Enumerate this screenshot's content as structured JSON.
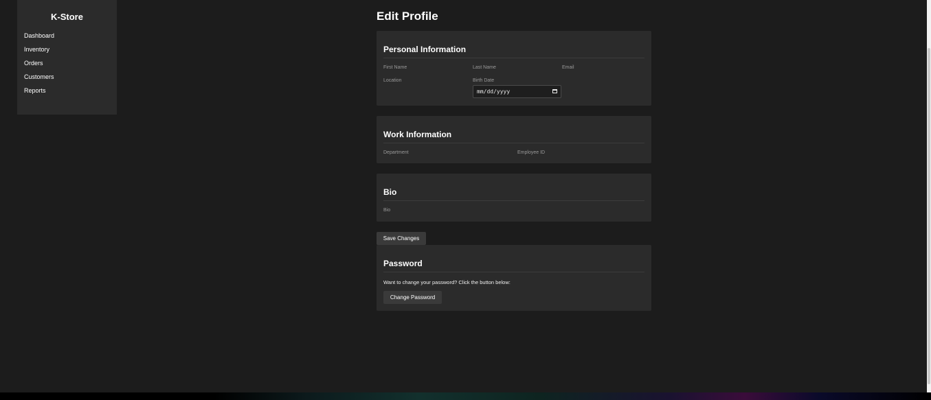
{
  "sidebar": {
    "brand": "K-Store",
    "items": [
      {
        "label": "Dashboard"
      },
      {
        "label": "Inventory"
      },
      {
        "label": "Orders"
      },
      {
        "label": "Customers"
      },
      {
        "label": "Reports"
      }
    ]
  },
  "page": {
    "title": "Edit Profile"
  },
  "personal": {
    "heading": "Personal Information",
    "first_name_label": "First Name",
    "last_name_label": "Last Name",
    "email_label": "Email",
    "location_label": "Location",
    "birth_date_label": "Birth Date",
    "birth_date_placeholder": "mm/dd/yyyy"
  },
  "work": {
    "heading": "Work Information",
    "department_label": "Department",
    "employee_id_label": "Employee ID"
  },
  "bio": {
    "heading": "Bio",
    "bio_label": "Bio"
  },
  "actions": {
    "save_label": "Save Changes"
  },
  "password": {
    "heading": "Password",
    "description": "Want to change your password? Click the button below:",
    "change_label": "Change Password"
  },
  "icons": {
    "calendar": "calendar-icon"
  },
  "colors": {
    "background": "#1c1c1c",
    "card": "#2b2b2b",
    "button": "#3a3a3a"
  }
}
